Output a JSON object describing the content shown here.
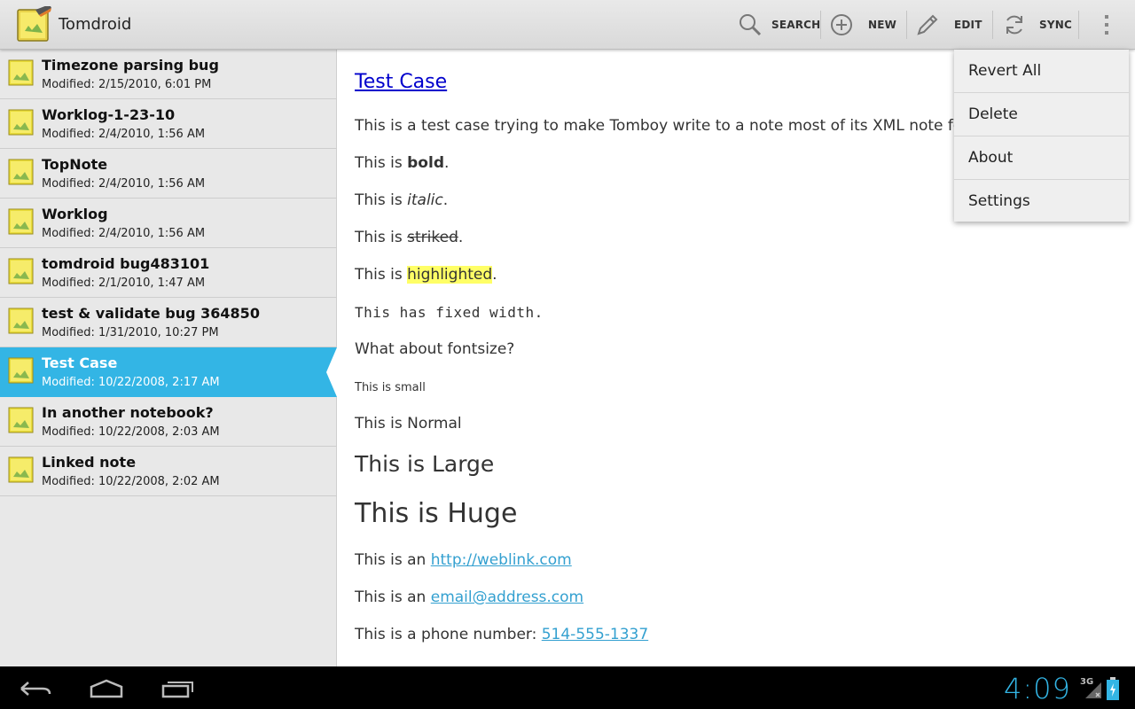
{
  "app": {
    "title": "Tomdroid"
  },
  "actions": {
    "search": "SEARCH",
    "new": "NEW",
    "edit": "EDIT",
    "sync": "SYNC"
  },
  "notes": [
    {
      "title": "Timezone parsing bug",
      "modified": "Modified: 2/15/2010, 6:01 PM"
    },
    {
      "title": "Worklog-1-23-10",
      "modified": "Modified: 2/4/2010, 1:56 AM"
    },
    {
      "title": "TopNote",
      "modified": "Modified: 2/4/2010, 1:56 AM"
    },
    {
      "title": "Worklog",
      "modified": "Modified: 2/4/2010, 1:56 AM"
    },
    {
      "title": "tomdroid bug483101",
      "modified": "Modified: 2/1/2010, 1:47 AM"
    },
    {
      "title": "test & validate bug 364850",
      "modified": "Modified: 1/31/2010, 10:27 PM"
    },
    {
      "title": "Test Case",
      "modified": "Modified: 10/22/2008, 2:17 AM",
      "selected": true
    },
    {
      "title": "In another notebook?",
      "modified": "Modified: 10/22/2008, 2:03 AM"
    },
    {
      "title": "Linked note",
      "modified": "Modified: 10/22/2008, 2:02 AM"
    }
  ],
  "note": {
    "title": "Test Case",
    "intro": "This is a test case trying to make Tomboy write to a note most of its XML note format",
    "bold_prefix": "This is ",
    "bold_word": "bold",
    "bold_suffix": ".",
    "italic_prefix": "This is ",
    "italic_word": "italic",
    "italic_suffix": ".",
    "strike_prefix": "This is ",
    "strike_word": "striked",
    "strike_suffix": ".",
    "highlight_prefix": "This is ",
    "highlight_word": "highlighted",
    "highlight_suffix": ".",
    "fixed": "This has fixed width.",
    "fontsize_q": "What about fontsize?",
    "small": "This is small",
    "normal": "This is Normal",
    "large": "This is Large",
    "huge": "This is Huge",
    "web_prefix": "This is an ",
    "web_link": "http://weblink.com",
    "email_prefix": "This is an ",
    "email_link": "email@address.com",
    "phone_prefix": "This is a phone number: ",
    "phone_link": "514-555-1337"
  },
  "menu": {
    "items": [
      "Revert All",
      "Delete",
      "About",
      "Settings"
    ]
  },
  "status": {
    "time": "4:09",
    "network": "3G"
  },
  "colors": {
    "accent": "#33b5e5",
    "highlight": "#ffff66",
    "link": "#33a0d0"
  }
}
